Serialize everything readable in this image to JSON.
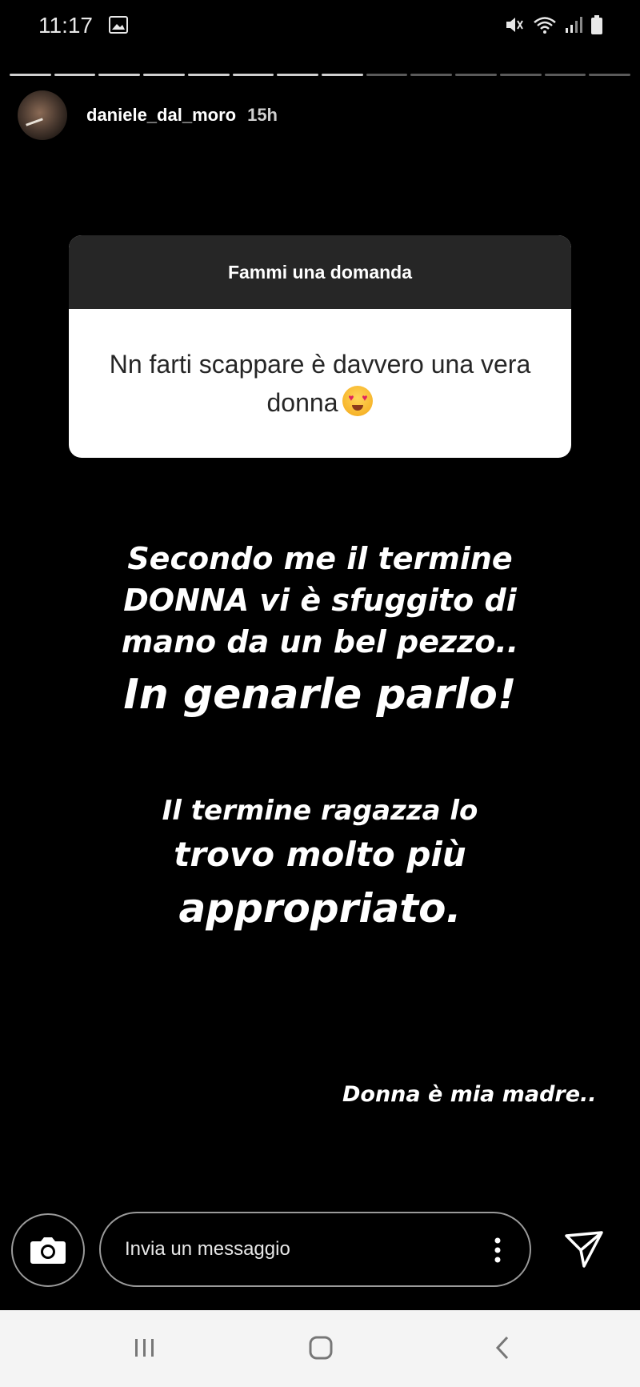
{
  "status_bar": {
    "time": "11:17",
    "icons": [
      "image-icon",
      "mute-icon",
      "wifi-icon",
      "signal-icon",
      "battery-icon"
    ]
  },
  "story": {
    "progress": {
      "segments_total": 14,
      "segments_done": 8
    },
    "username": "daniele_dal_moro",
    "age": "15h"
  },
  "question_box": {
    "header": "Fammi una domanda",
    "answer": "Nn farti scappare è davvero una vera donna"
  },
  "text_blocks": {
    "line1": "Secondo me il termine DONNA vi è sfuggito di mano da un bel pezzo..",
    "line2": "In genarle parlo!",
    "line3": "Il termine ragazza lo",
    "line4": "trovo molto più",
    "line5": "appropriato.",
    "line6": "Donna è mia madre.."
  },
  "reply_bar": {
    "placeholder": "Invia un messaggio"
  },
  "colors": {
    "background": "#000000",
    "question_header_bg": "#262626",
    "question_body_bg": "#ffffff",
    "nav_bar_bg": "#f4f4f4"
  }
}
